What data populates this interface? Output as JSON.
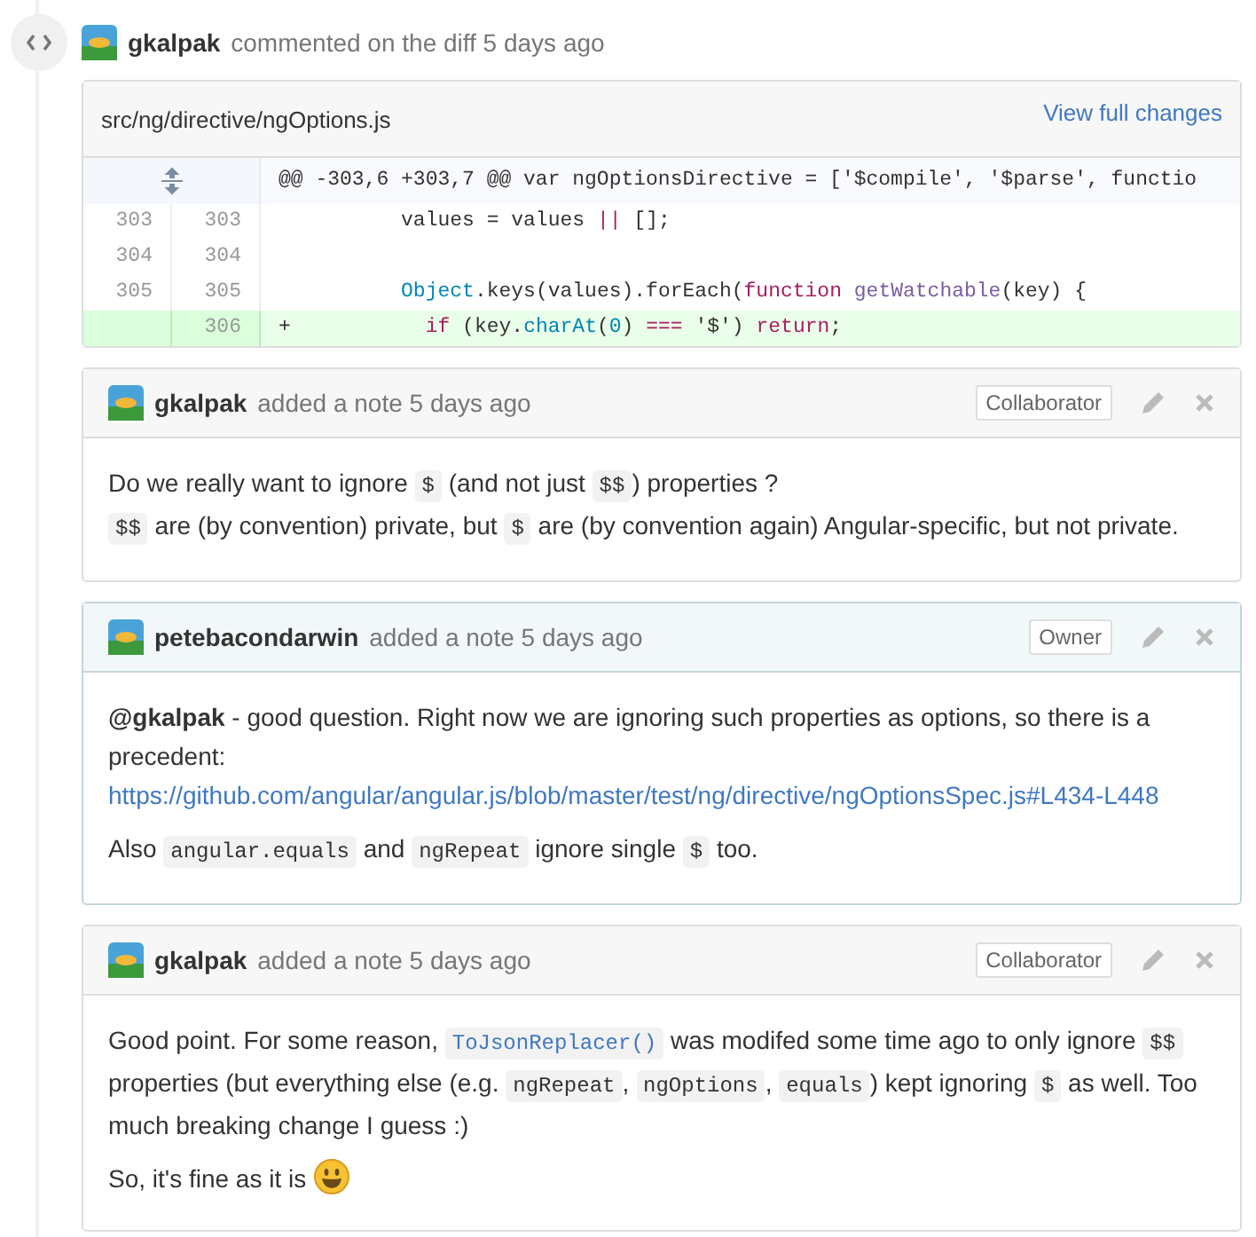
{
  "event": {
    "author": "gkalpak",
    "action": "commented on the diff 5 days ago"
  },
  "diff": {
    "file": "src/ng/directive/ngOptions.js",
    "view_link": "View full changes",
    "lines": [
      {
        "kind": "hunk",
        "tokens": [
          {
            "kind": "plain",
            "text": "@@ -303,6 +303,7 @@ var ngOptionsDirective = ['$compile', '$parse', functio"
          }
        ]
      },
      {
        "kind": "context",
        "old": "303",
        "new": "303",
        "tokens": [
          {
            "kind": "plain",
            "text": "        values = values "
          },
          {
            "kind": "keyword",
            "text": "||"
          },
          {
            "kind": "plain",
            "text": " [];"
          }
        ]
      },
      {
        "kind": "context",
        "old": "304",
        "new": "304"
      },
      {
        "kind": "context",
        "old": "305",
        "new": "305",
        "tokens": [
          {
            "kind": "builtin",
            "text": "        Object"
          },
          {
            "kind": "plain",
            "text": ".keys(values).forEach("
          },
          {
            "kind": "keyword",
            "text": "function"
          },
          {
            "kind": "func",
            "text": " getWatchable"
          },
          {
            "kind": "plain",
            "text": "(key) {"
          }
        ]
      },
      {
        "kind": "added",
        "new": "306",
        "sign": "+",
        "tokens": [
          {
            "kind": "keyword",
            "text": "          if"
          },
          {
            "kind": "plain",
            "text": " (key."
          },
          {
            "kind": "builtin",
            "text": "charAt"
          },
          {
            "kind": "plain",
            "text": "("
          },
          {
            "kind": "builtin",
            "text": "0"
          },
          {
            "kind": "plain",
            "text": ") "
          },
          {
            "kind": "keyword",
            "text": "==="
          },
          {
            "kind": "plain",
            "text": " '$') "
          },
          {
            "kind": "keyword",
            "text": "return"
          },
          {
            "kind": "plain",
            "text": ";"
          }
        ]
      }
    ]
  },
  "notes": [
    {
      "author": "gkalpak",
      "meta": "added a note 5 days ago",
      "role": "Collaborator",
      "selected": false,
      "paragraphs": [
        [
          {
            "kind": "text",
            "text": "Do we really want to ignore "
          },
          {
            "kind": "code",
            "text": "$"
          },
          {
            "kind": "text",
            "text": " (and not just "
          },
          {
            "kind": "code",
            "text": "$$"
          },
          {
            "kind": "text",
            "text": ") properties ?"
          },
          {
            "kind": "break"
          },
          {
            "kind": "code",
            "text": "$$"
          },
          {
            "kind": "text",
            "text": " are (by convention) private, but "
          },
          {
            "kind": "code",
            "text": "$"
          },
          {
            "kind": "text",
            "text": " are (by convention again) Angular-specific, but not private."
          }
        ]
      ]
    },
    {
      "author": "petebacondarwin",
      "meta": "added a note 5 days ago",
      "role": "Owner",
      "selected": true,
      "paragraphs": [
        [
          {
            "kind": "mention",
            "text": "@gkalpak"
          },
          {
            "kind": "text",
            "text": " - good question. Right now we are ignoring such properties as options, so there is a precedent:"
          },
          {
            "kind": "break"
          },
          {
            "kind": "link",
            "text": "https://github.com/angular/angular.js/blob/master/test/ng/directive/ngOptionsSpec.js#L434-L448"
          }
        ],
        [
          {
            "kind": "text",
            "text": "Also "
          },
          {
            "kind": "code",
            "text": "angular.equals"
          },
          {
            "kind": "text",
            "text": " and "
          },
          {
            "kind": "code",
            "text": "ngRepeat"
          },
          {
            "kind": "text",
            "text": " ignore single "
          },
          {
            "kind": "code",
            "text": "$"
          },
          {
            "kind": "text",
            "text": " too."
          }
        ]
      ]
    },
    {
      "author": "gkalpak",
      "meta": "added a note 5 days ago",
      "role": "Collaborator",
      "selected": false,
      "paragraphs": [
        [
          {
            "kind": "text",
            "text": "Good point. For some reason, "
          },
          {
            "kind": "codelink",
            "text": "ToJsonReplacer()"
          },
          {
            "kind": "text",
            "text": " was modifed some time ago to only ignore "
          },
          {
            "kind": "code",
            "text": "$$"
          },
          {
            "kind": "text",
            "text": " properties (but everything else (e.g. "
          },
          {
            "kind": "code",
            "text": "ngRepeat"
          },
          {
            "kind": "text",
            "text": ", "
          },
          {
            "kind": "code",
            "text": "ngOptions"
          },
          {
            "kind": "text",
            "text": ", "
          },
          {
            "kind": "code",
            "text": "equals"
          },
          {
            "kind": "text",
            "text": ") kept ignoring "
          },
          {
            "kind": "code",
            "text": "$"
          },
          {
            "kind": "text",
            "text": " as well. Too much breaking change I guess :)"
          }
        ],
        [
          {
            "kind": "text",
            "text": "So, it's fine as it is "
          },
          {
            "kind": "emoji"
          }
        ]
      ]
    }
  ]
}
